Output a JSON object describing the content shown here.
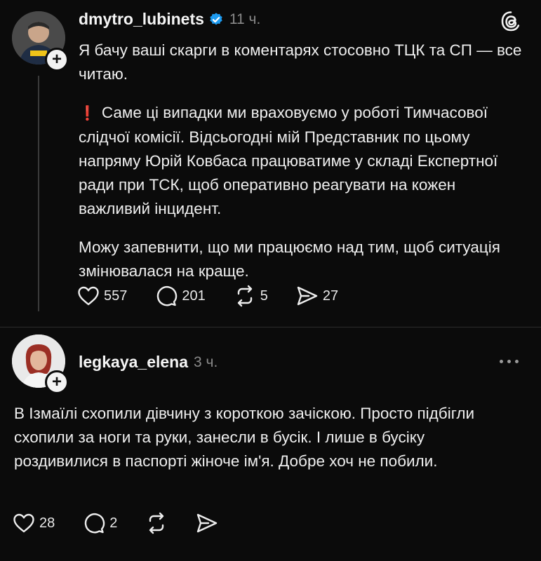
{
  "post": {
    "username": "dmytro_lubinets",
    "time": "11 ч.",
    "paragraphs": [
      "Я бачу ваші скарги в коментарях стосовно ТЦК та СП — все читаю.",
      "Саме ці випадки ми враховуємо у роботі Тимчасової слідчої комісії. Відсьогодні мій Представник по цьому напряму Юрій Ковбаса працюватиме у складі Експертної ради при ТСК, щоб оперативно реагувати на кожен важливий інцидент.",
      "Можу запевнити, що ми працюємо над тим, щоб ситуація змінювалася на краще."
    ],
    "exclamation": "❗",
    "likes": "557",
    "comments": "201",
    "reposts": "5",
    "shares": "27"
  },
  "reply": {
    "username": "legkaya_elena",
    "time": "3 ч.",
    "text": "В Ізмаїлі схопили дівчину з короткою зачіскою. Просто підбігли схопили за ноги та руки, занесли в бусік. І лише в бусіку роздивилися в паспорті жіноче ім'я. Добре хоч не побили.",
    "likes": "28",
    "comments": "2"
  },
  "icons": {
    "verified": "verified-badge-icon",
    "threads": "threads-logo-icon",
    "heart": "heart-icon",
    "comment": "comment-icon",
    "repost": "repost-icon",
    "share": "share-icon",
    "more": "more-icon",
    "plus": "follow-plus-icon"
  },
  "colors": {
    "background": "#0b0b0b",
    "verified": "#1d9bf0",
    "exclamation": "#e0245e"
  }
}
